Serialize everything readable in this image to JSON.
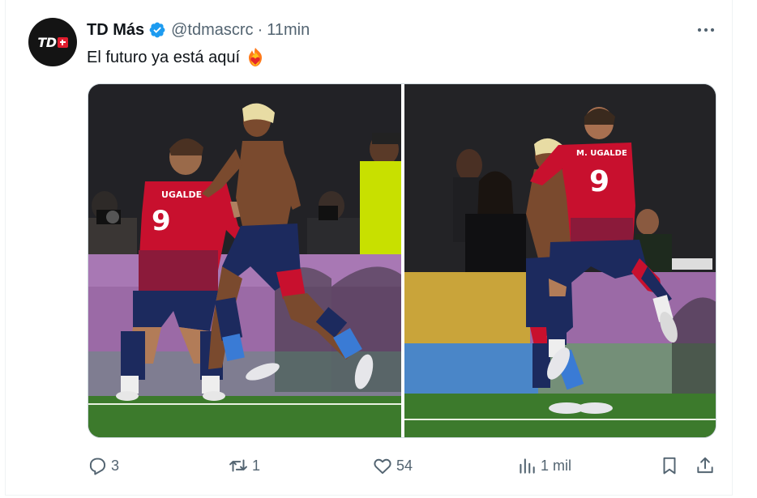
{
  "tweet": {
    "author": {
      "display_name": "TD Más",
      "handle": "@tdmascrc",
      "avatar_logo_text": "TD",
      "verified": true
    },
    "separator": "·",
    "time": "11min",
    "text": "El futuro ya está aquí",
    "emoji": "heart-on-fire-emoji",
    "media": [
      {
        "jersey_name": "M. UGALDE",
        "jersey_number": "9",
        "icon": "soccer-celebration-photo"
      },
      {
        "jersey_name": "M. UGALDE",
        "jersey_number": "9",
        "icon": "soccer-celebration-photo"
      }
    ],
    "actions": {
      "reply_count": "3",
      "retweet_count": "1",
      "like_count": "54",
      "views_count": "1 mil"
    }
  },
  "colors": {
    "verified_badge": "#1d9bf0",
    "secondary_text": "#536471",
    "primary_text": "#0f1419",
    "jersey_red": "#c8102e",
    "shorts_navy": "#1c2a5e",
    "pitch_green": "#3c7a2c"
  }
}
